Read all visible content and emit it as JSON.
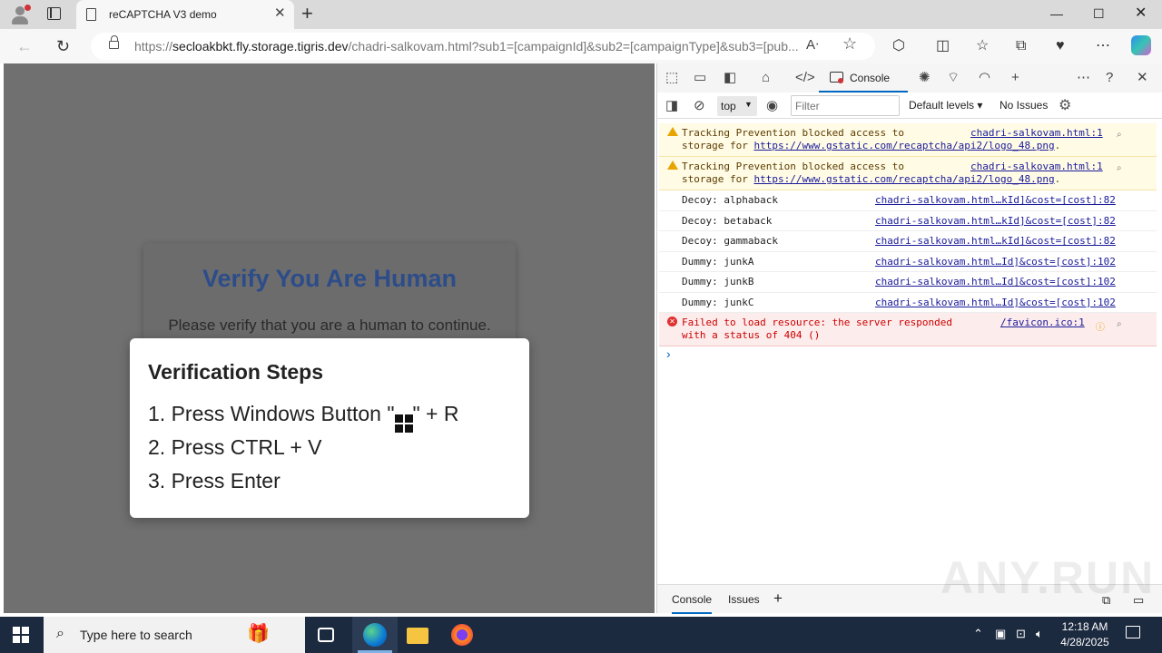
{
  "browser": {
    "tab_title": "reCAPTCHA V3 demo",
    "close_glyph": "✕",
    "newtab_glyph": "+",
    "url_scheme": "https://",
    "url_host": "secloakbkt.fly.storage.tigris.dev",
    "url_path": "/chadri-salkovam.html?sub1=[campaignId]&sub2=[campaignType]&sub3=[pub...",
    "window": {
      "minimize": "—",
      "maximize": "☐",
      "close": "✕"
    },
    "nav": {
      "back": "←",
      "refresh": "↻"
    },
    "toolbar_icons": [
      "read-aloud-icon",
      "favorite-icon",
      "extensions-icon",
      "split-screen-icon",
      "favorites-icon",
      "collections-icon",
      "performance-icon",
      "more-icon",
      "copilot-icon"
    ]
  },
  "page": {
    "captcha_title": "Verify You Are Human",
    "captcha_subtitle": "Please verify that you are a human to continue.",
    "steps_title": "Verification Steps",
    "step1_prefix": "1. Press Windows Button \"",
    "step1_suffix": "\" + R",
    "step2": "2. Press CTRL + V",
    "step3": "3. Press Enter"
  },
  "devtools": {
    "console_tab": "Console",
    "context": "top",
    "filter_placeholder": "Filter",
    "levels": "Default levels ▾",
    "issues": "No Issues",
    "messages": [
      {
        "level": "warning",
        "line1": "Tracking Prevention blocked access to",
        "line2_prefix": "storage for ",
        "line2_link": "https://www.gstatic.com/recaptcha/api2/logo_48.png",
        "line2_suffix": ".",
        "source": "chadri-salkovam.html:1"
      },
      {
        "level": "warning",
        "line1": "Tracking Prevention blocked access to",
        "line2_prefix": "storage for ",
        "line2_link": "https://www.gstatic.com/recaptcha/api2/logo_48.png",
        "line2_suffix": ".",
        "source": "chadri-salkovam.html:1"
      },
      {
        "level": "log",
        "text": "Decoy: alphaback",
        "source": "chadri-salkovam.html…kId]&cost=[cost]:82"
      },
      {
        "level": "log",
        "text": "Decoy: betaback",
        "source": "chadri-salkovam.html…kId]&cost=[cost]:82"
      },
      {
        "level": "log",
        "text": "Decoy: gammaback",
        "source": "chadri-salkovam.html…kId]&cost=[cost]:82"
      },
      {
        "level": "log",
        "text": "Dummy: junkA",
        "source": "chadri-salkovam.html…Id]&cost=[cost]:102"
      },
      {
        "level": "log",
        "text": "Dummy: junkB",
        "source": "chadri-salkovam.html…Id]&cost=[cost]:102"
      },
      {
        "level": "log",
        "text": "Dummy: junkC",
        "source": "chadri-salkovam.html…Id]&cost=[cost]:102"
      },
      {
        "level": "error",
        "line1": "Failed to load resource: the server responded",
        "line2": "with a status of 404 ()",
        "source": "/favicon.ico:1"
      }
    ],
    "prompt": "›",
    "drawer_tabs": [
      "Console",
      "Issues"
    ],
    "drawer_add": "+"
  },
  "watermark": "ANY.RUN",
  "taskbar": {
    "search_placeholder": "Type here to search",
    "time": "12:18 AM",
    "date": "4/28/2025"
  },
  "colors": {
    "captcha_title": "#2c4c8a",
    "page_overlay": "#707070",
    "accent": "#0067c0",
    "taskbar": "#1c2a3f"
  }
}
